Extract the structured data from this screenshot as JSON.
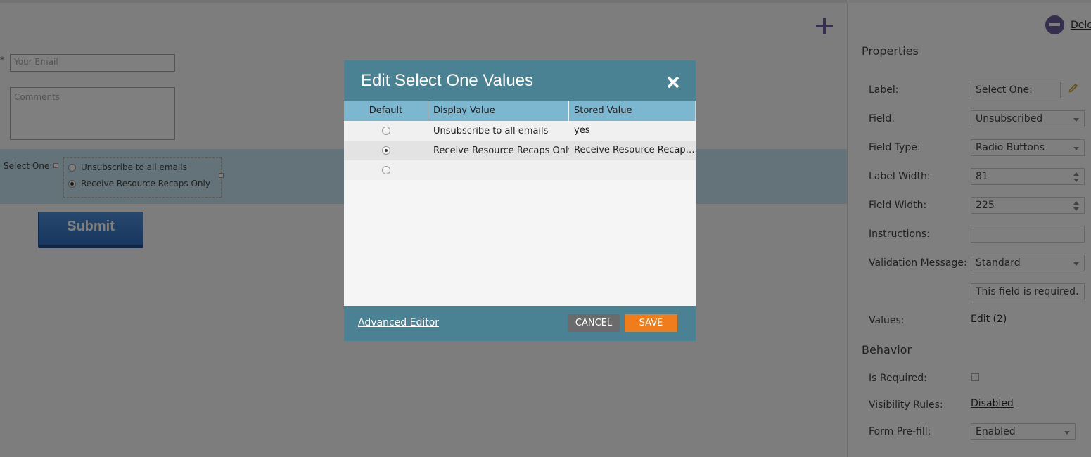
{
  "canvas": {
    "email_placeholder": "Your Email",
    "comments_placeholder": "Comments",
    "required_marker": "*",
    "select_label": "Select One",
    "options": [
      "Unsubscribe to all emails",
      "Receive Resource Recaps Only"
    ],
    "submit_label": "Submit"
  },
  "panel": {
    "delete_label": "Dele",
    "properties_title": "Properties",
    "behavior_title": "Behavior",
    "props": {
      "label": {
        "name": "Label:",
        "value": "Select One:"
      },
      "field": {
        "name": "Field:",
        "value": "Unsubscribed"
      },
      "field_type": {
        "name": "Field Type:",
        "value": "Radio Buttons"
      },
      "label_width": {
        "name": "Label Width:",
        "value": "81"
      },
      "field_width": {
        "name": "Field Width:",
        "value": "225"
      },
      "instructions": {
        "name": "Instructions:",
        "value": ""
      },
      "validation_message": {
        "name": "Validation Message:",
        "value": "Standard",
        "message": "This field is required."
      },
      "values": {
        "name": "Values:",
        "link": "Edit (2)"
      }
    },
    "behavior": {
      "is_required": {
        "name": "Is Required:"
      },
      "visibility_rules": {
        "name": "Visibility Rules:",
        "link": "Disabled"
      },
      "form_prefill": {
        "name": "Form Pre-fill:",
        "value": "Enabled"
      }
    }
  },
  "modal": {
    "title": "Edit Select One Values",
    "columns": [
      "Default",
      "Display Value",
      "Stored Value"
    ],
    "rows": [
      {
        "display": "Unsubscribe to all emails",
        "stored": "yes",
        "default": false
      },
      {
        "display": "Receive Resource Recaps Only",
        "stored": "Receive Resource Recaps Only",
        "default": true
      },
      {
        "display": "",
        "stored": "",
        "default": false
      }
    ],
    "advanced_editor_label": "Advanced Editor",
    "cancel_label": "CANCEL",
    "save_label": "SAVE"
  },
  "colors": {
    "modal_header": "#4a8293",
    "grid_header": "#7cb6cf",
    "save_button": "#f07c1b",
    "cancel_button": "#6b6b6b",
    "accent_icon": "#6a5d9a"
  }
}
